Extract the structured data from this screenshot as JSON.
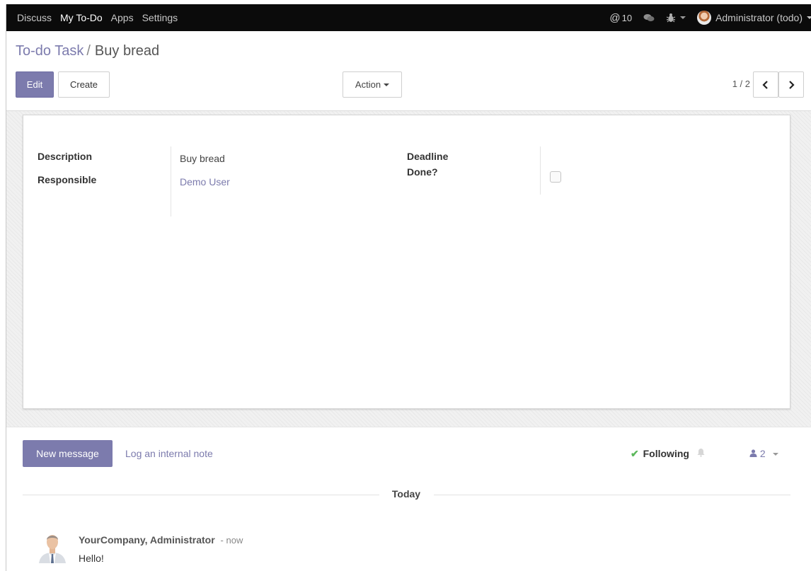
{
  "navbar": {
    "items": [
      {
        "label": "Discuss",
        "active": false
      },
      {
        "label": "My To-Do",
        "active": true
      },
      {
        "label": "Apps",
        "active": false
      },
      {
        "label": "Settings",
        "active": false
      }
    ],
    "mentions_icon": "at-icon",
    "mentions_count": "10",
    "chat_icon": "chat-bubbles-icon",
    "debug_icon": "bug-icon",
    "user_label": "Administrator (todo)"
  },
  "breadcrumb": {
    "parent": "To-do Task",
    "separator": "/",
    "current": "Buy bread"
  },
  "toolbar": {
    "edit_label": "Edit",
    "create_label": "Create",
    "action_label": "Action",
    "pager": "1 / 2"
  },
  "form": {
    "description_label": "Description",
    "description_value": "Buy bread",
    "responsible_label": "Responsible",
    "responsible_value": "Demo User",
    "deadline_label": "Deadline",
    "deadline_value": "",
    "done_label": "Done?",
    "done_checked": false
  },
  "chatter": {
    "new_message_label": "New message",
    "log_note_label": "Log an internal note",
    "following_label": "Following",
    "followers_count": "2",
    "date_separator": "Today",
    "message": {
      "author": "YourCompany, Administrator",
      "time": "- now",
      "body": "Hello!"
    }
  },
  "colors": {
    "brand": "#7c7bad",
    "navbar_bg": "#0b0b0b",
    "success": "#5cb85c"
  }
}
